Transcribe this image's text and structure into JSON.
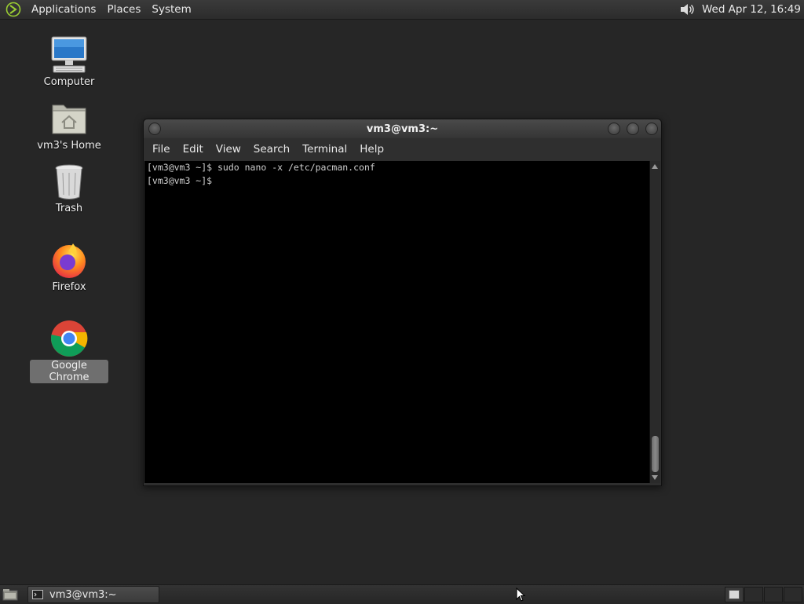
{
  "top_panel": {
    "menus": [
      "Applications",
      "Places",
      "System"
    ],
    "clock": "Wed Apr 12, 16:49"
  },
  "desktop_icons": [
    {
      "label": "Computer",
      "icon": "computer-icon",
      "selected": false
    },
    {
      "label": "vm3's Home",
      "icon": "home-folder-icon",
      "selected": false
    },
    {
      "label": "Trash",
      "icon": "trash-icon",
      "selected": false
    },
    {
      "label": "Firefox",
      "icon": "firefox-icon",
      "selected": false
    },
    {
      "label": "Google Chrome",
      "icon": "chrome-icon",
      "selected": true
    }
  ],
  "terminal": {
    "title": "vm3@vm3:~",
    "menu": [
      "File",
      "Edit",
      "View",
      "Search",
      "Terminal",
      "Help"
    ],
    "lines": [
      "[vm3@vm3 ~]$ sudo nano -x /etc/pacman.conf",
      "[vm3@vm3 ~]$ "
    ],
    "scroll_position": 1.0
  },
  "bottom_panel": {
    "task_label": "vm3@vm3:~",
    "workspaces": 4,
    "active_workspace": 1
  },
  "colors": {
    "desktop_bg": "#262626",
    "terminal_bg": "#000000",
    "terminal_fg": "#cfcfcf",
    "selection_label_bg": "#6f6f6f"
  }
}
